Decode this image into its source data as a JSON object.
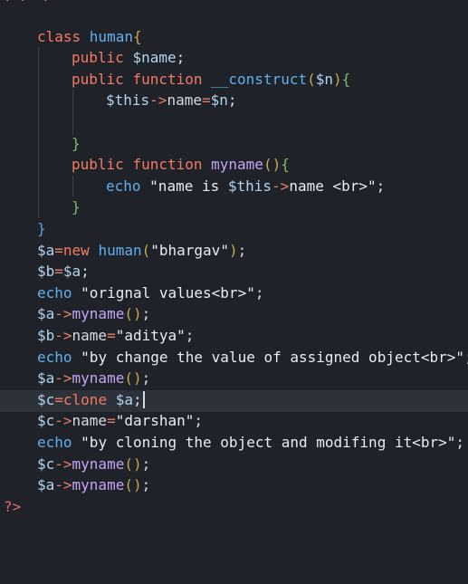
{
  "editor": {
    "top_fragment": "· ·  ·",
    "lines": [
      [
        {
          "t": "class ",
          "c": "kw"
        },
        {
          "t": "human",
          "c": "cls"
        },
        {
          "t": "{",
          "c": "brace"
        }
      ],
      [
        {
          "t": "public ",
          "c": "kw"
        },
        {
          "t": "$name",
          "c": "var"
        },
        {
          "t": ";",
          "c": "plain"
        }
      ],
      [
        {
          "t": "public ",
          "c": "kw"
        },
        {
          "t": "function ",
          "c": "kw"
        },
        {
          "t": "__construct",
          "c": "cls"
        },
        {
          "t": "(",
          "c": "paren"
        },
        {
          "t": "$n",
          "c": "var"
        },
        {
          "t": ")",
          "c": "paren"
        },
        {
          "t": "{",
          "c": "brace-green"
        }
      ],
      [
        {
          "t": "$this",
          "c": "var"
        },
        {
          "t": "->",
          "c": "op"
        },
        {
          "t": "name",
          "c": "plain"
        },
        {
          "t": "=",
          "c": "op"
        },
        {
          "t": "$n",
          "c": "var"
        },
        {
          "t": ";",
          "c": "plain"
        }
      ],
      [],
      [
        {
          "t": "}",
          "c": "brace-green"
        }
      ],
      [
        {
          "t": "public ",
          "c": "kw"
        },
        {
          "t": "function ",
          "c": "kw"
        },
        {
          "t": "myname",
          "c": "fn"
        },
        {
          "t": "()",
          "c": "paren"
        },
        {
          "t": "{",
          "c": "brace-green"
        }
      ],
      [
        {
          "t": "echo ",
          "c": "echo"
        },
        {
          "t": "\"name is ",
          "c": "str"
        },
        {
          "t": "$this",
          "c": "var"
        },
        {
          "t": "->",
          "c": "op"
        },
        {
          "t": "name <br>\"",
          "c": "str"
        },
        {
          "t": ";",
          "c": "plain"
        }
      ],
      [
        {
          "t": "}",
          "c": "brace-green"
        }
      ],
      [
        {
          "t": "}",
          "c": "brace-blue"
        }
      ],
      [
        {
          "t": "$a",
          "c": "var"
        },
        {
          "t": "=",
          "c": "op"
        },
        {
          "t": "new ",
          "c": "kw"
        },
        {
          "t": "human",
          "c": "cls"
        },
        {
          "t": "(",
          "c": "paren"
        },
        {
          "t": "\"bhargav\"",
          "c": "str"
        },
        {
          "t": ")",
          "c": "paren"
        },
        {
          "t": ";",
          "c": "plain"
        }
      ],
      [
        {
          "t": "$b",
          "c": "var"
        },
        {
          "t": "=",
          "c": "op"
        },
        {
          "t": "$a",
          "c": "var"
        },
        {
          "t": ";",
          "c": "plain"
        }
      ],
      [
        {
          "t": "echo ",
          "c": "echo"
        },
        {
          "t": "\"orignal values<br>\"",
          "c": "str"
        },
        {
          "t": ";",
          "c": "plain"
        }
      ],
      [
        {
          "t": "$a",
          "c": "var"
        },
        {
          "t": "->",
          "c": "op"
        },
        {
          "t": "myname",
          "c": "fn"
        },
        {
          "t": "()",
          "c": "paren"
        },
        {
          "t": ";",
          "c": "plain"
        }
      ],
      [
        {
          "t": "$b",
          "c": "var"
        },
        {
          "t": "->",
          "c": "op"
        },
        {
          "t": "name",
          "c": "plain"
        },
        {
          "t": "=",
          "c": "op"
        },
        {
          "t": "\"aditya\"",
          "c": "str"
        },
        {
          "t": ";",
          "c": "plain"
        }
      ],
      [
        {
          "t": "echo ",
          "c": "echo"
        },
        {
          "t": "\"by change the value of assigned object<br>\"",
          "c": "str"
        },
        {
          "t": ";",
          "c": "plain"
        }
      ],
      [
        {
          "t": "$a",
          "c": "var"
        },
        {
          "t": "->",
          "c": "op"
        },
        {
          "t": "myname",
          "c": "fn"
        },
        {
          "t": "()",
          "c": "paren"
        },
        {
          "t": ";",
          "c": "plain"
        }
      ],
      [
        {
          "t": "$c",
          "c": "var"
        },
        {
          "t": "=",
          "c": "op"
        },
        {
          "t": "clone ",
          "c": "kw"
        },
        {
          "t": "$a",
          "c": "var"
        },
        {
          "t": ";",
          "c": "plain"
        }
      ],
      [
        {
          "t": "$c",
          "c": "var"
        },
        {
          "t": "->",
          "c": "op"
        },
        {
          "t": "name",
          "c": "plain"
        },
        {
          "t": "=",
          "c": "op"
        },
        {
          "t": "\"darshan\"",
          "c": "str"
        },
        {
          "t": ";",
          "c": "plain"
        }
      ],
      [
        {
          "t": "echo ",
          "c": "echo"
        },
        {
          "t": "\"by cloning the object and modifing it<br>\"",
          "c": "str"
        },
        {
          "t": ";",
          "c": "plain"
        }
      ],
      [
        {
          "t": "$c",
          "c": "var"
        },
        {
          "t": "->",
          "c": "op"
        },
        {
          "t": "myname",
          "c": "fn"
        },
        {
          "t": "()",
          "c": "paren"
        },
        {
          "t": ";",
          "c": "plain"
        }
      ],
      [
        {
          "t": "$a",
          "c": "var"
        },
        {
          "t": "->",
          "c": "op"
        },
        {
          "t": "myname",
          "c": "fn"
        },
        {
          "t": "()",
          "c": "paren"
        },
        {
          "t": ";",
          "c": "plain"
        }
      ],
      [
        {
          "t": "?>",
          "c": "tag"
        }
      ]
    ]
  }
}
